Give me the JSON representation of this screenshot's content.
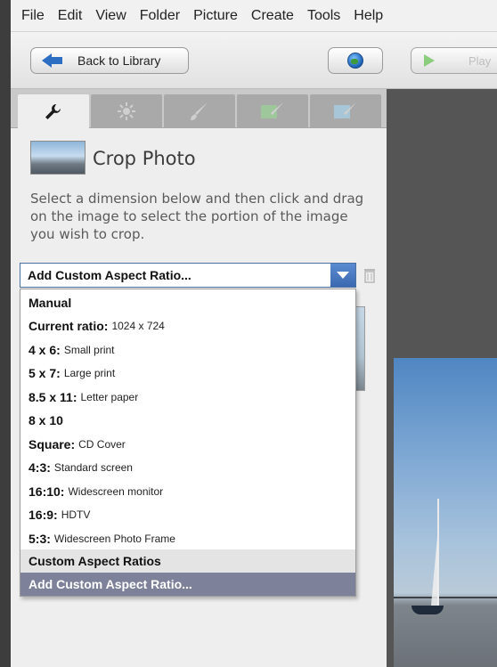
{
  "menubar": {
    "items": [
      "File",
      "Edit",
      "View",
      "Folder",
      "Picture",
      "Create",
      "Tools",
      "Help"
    ]
  },
  "toolbar": {
    "back_label": "Back to Library",
    "play_label": "Play"
  },
  "panel": {
    "tabs": [
      {
        "icon": "wrench-icon",
        "active": true
      },
      {
        "icon": "sun-icon",
        "active": false
      },
      {
        "icon": "brush-icon",
        "active": false
      },
      {
        "icon": "effects-brush-icon",
        "active": false
      },
      {
        "icon": "effects-brush-alt-icon",
        "active": false
      }
    ],
    "title": "Crop Photo",
    "instructions": "Select a dimension below and then click and drag on the image to select the portion of the image you wish to crop.",
    "aspect_select": {
      "value": "Add Custom Aspect Ratio...",
      "options": [
        {
          "label": "Manual",
          "sub": ""
        },
        {
          "label": "Current ratio:",
          "sub": "1024 x 724"
        },
        {
          "label": "4 x 6:",
          "sub": "Small print"
        },
        {
          "label": "5 x 7:",
          "sub": "Large print"
        },
        {
          "label": "8.5 x 11:",
          "sub": "Letter paper"
        },
        {
          "label": "8 x 10",
          "sub": ""
        },
        {
          "label": "Square:",
          "sub": "CD Cover"
        },
        {
          "label": "4:3:",
          "sub": "Standard screen"
        },
        {
          "label": "16:10:",
          "sub": "Widescreen monitor"
        },
        {
          "label": "16:9:",
          "sub": "HDTV"
        },
        {
          "label": "5:3:",
          "sub": "Widescreen Photo Frame"
        }
      ],
      "section_label": "Custom Aspect Ratios",
      "selected_label": "Add Custom Aspect Ratio..."
    }
  },
  "colors": {
    "accent_blue": "#2b6ec2",
    "selected_row": "#7d8199",
    "panel_bg": "#eeeeee"
  }
}
